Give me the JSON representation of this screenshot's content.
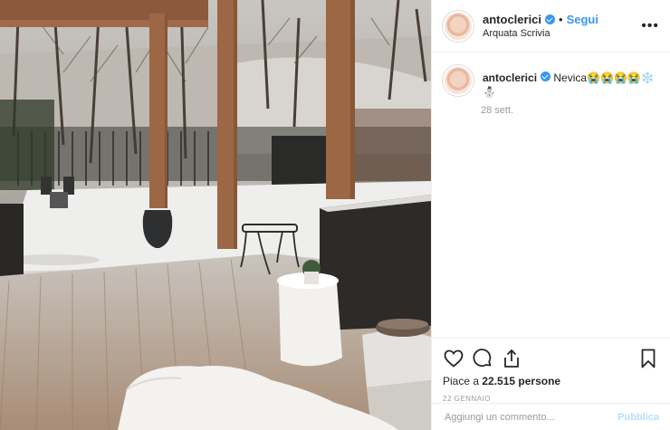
{
  "header": {
    "username": "antoclerici",
    "separator": "•",
    "follow_label": "Segui",
    "location": "Arquata Scrivia",
    "more_label": "•••"
  },
  "caption": {
    "username": "antoclerici",
    "text": "Nevica",
    "emojis": "😭😭😭😭❄️⛄",
    "time": "28 sett."
  },
  "actions": {
    "icons": [
      "heart-icon",
      "comment-icon",
      "share-icon",
      "bookmark-icon"
    ],
    "likes_label": "Piace a ",
    "likes_count": "22.515 persone",
    "date": "22 gennaio"
  },
  "comment_box": {
    "placeholder": "Aggiungi un commento...",
    "publish_label": "Pubblica"
  },
  "colors": {
    "link_blue": "#3897f0",
    "text_dark": "#262626",
    "text_grey": "#999999",
    "publish_disabled": "#b2dffc"
  }
}
